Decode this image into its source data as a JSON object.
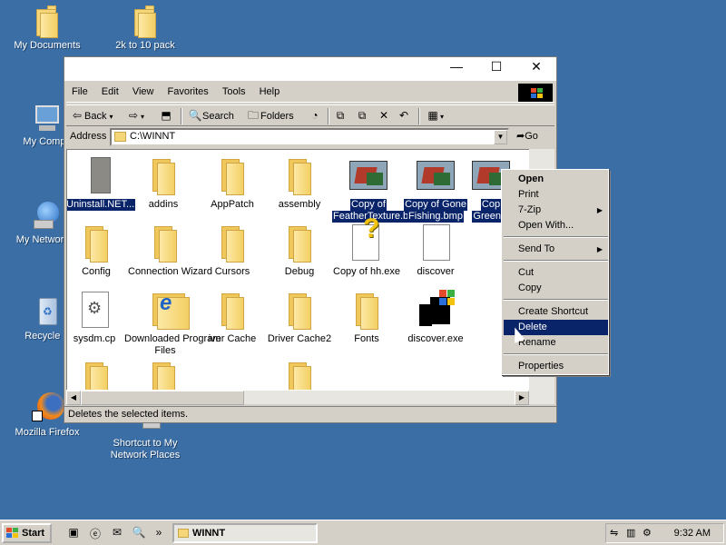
{
  "desktop": {
    "icons": [
      {
        "label": "My Documents",
        "name": "desktop-icon-my-documents"
      },
      {
        "label": "2k to 10 pack",
        "name": "desktop-icon-2k-to-10-pack"
      },
      {
        "label": "My Compu",
        "name": "desktop-icon-my-computer"
      },
      {
        "label": "My Network P",
        "name": "desktop-icon-my-network-places"
      },
      {
        "label": "Recycle B",
        "name": "desktop-icon-recycle-bin"
      },
      {
        "label": "Mozilla Firefox",
        "name": "desktop-icon-mozilla-firefox"
      },
      {
        "label": "Shortcut to My Network Places",
        "name": "desktop-icon-shortcut-network"
      }
    ]
  },
  "window": {
    "buttons": {
      "minimize": "—",
      "maximize": "☐",
      "close": "✕"
    },
    "menu": [
      "File",
      "Edit",
      "View",
      "Favorites",
      "Tools",
      "Help"
    ],
    "toolbar": {
      "back": "Back",
      "search": "Search",
      "folders": "Folders"
    },
    "address": {
      "label": "Address",
      "value": "C:\\WINNT",
      "go": "Go"
    },
    "files": [
      {
        "name": "Uninstall.NET...",
        "selected": true,
        "kind": "gray"
      },
      {
        "name": "addins",
        "selected": false,
        "kind": "folder"
      },
      {
        "name": "AppPatch",
        "selected": false,
        "kind": "folder"
      },
      {
        "name": "assembly",
        "selected": false,
        "kind": "folder"
      },
      {
        "name": "Copy of FeatherTexture.bmp",
        "selected": true,
        "kind": "image",
        "line1": "Copy of",
        "line2": "FeatherTexture.bn"
      },
      {
        "name": "Copy of Gone Fishing.bmp",
        "selected": true,
        "kind": "image",
        "line1": "Copy of Gone",
        "line2": "Fishing.bmp"
      },
      {
        "name": "Copy of Greenstone",
        "selected": true,
        "kind": "image",
        "line1": "Cop",
        "line2": "Greenst"
      },
      {
        "name": "Config",
        "selected": false,
        "kind": "folder"
      },
      {
        "name": "Connection Wizard",
        "selected": false,
        "kind": "folder"
      },
      {
        "name": "Cursors",
        "selected": false,
        "kind": "folder"
      },
      {
        "name": "Debug",
        "selected": false,
        "kind": "folder"
      },
      {
        "name": "Copy of hh.exe",
        "selected": false,
        "kind": "help"
      },
      {
        "name": "discover",
        "selected": false,
        "kind": "doc"
      },
      {
        "name": "sysdm.cpl",
        "selected": false,
        "kind": "cpl",
        "line1": "sysdm.cp"
      },
      {
        "name": "Downloaded Program Files",
        "selected": false,
        "kind": "ie",
        "line1": "Downloaded Program",
        "line2": "Files"
      },
      {
        "name": "Driver Cache",
        "selected": false,
        "kind": "folder",
        "line1": "iver Cache"
      },
      {
        "name": "Driver Cache2",
        "selected": false,
        "kind": "folder"
      },
      {
        "name": "Fonts",
        "selected": false,
        "kind": "folder"
      },
      {
        "name": "discover.exe",
        "selected": false,
        "kind": "exe"
      }
    ],
    "status": "Deletes the selected items."
  },
  "context_menu": {
    "items": [
      {
        "label": "Open",
        "bold": true
      },
      {
        "label": "Print"
      },
      {
        "label": "7-Zip",
        "submenu": true
      },
      {
        "label": "Open With..."
      },
      {
        "label": "Send To",
        "submenu": true
      },
      {
        "label": "Cut"
      },
      {
        "label": "Copy"
      },
      {
        "label": "Create Shortcut"
      },
      {
        "label": "Delete",
        "active": true
      },
      {
        "label": "Rename"
      },
      {
        "label": "Properties"
      }
    ]
  },
  "taskbar": {
    "start": "Start",
    "task": "WINNT",
    "clock": "9:32 AM",
    "chevron": "»"
  },
  "colors": {
    "desktop": "#3a6ea5",
    "selection": "#0a246a",
    "chrome": "#d4d0c8"
  }
}
